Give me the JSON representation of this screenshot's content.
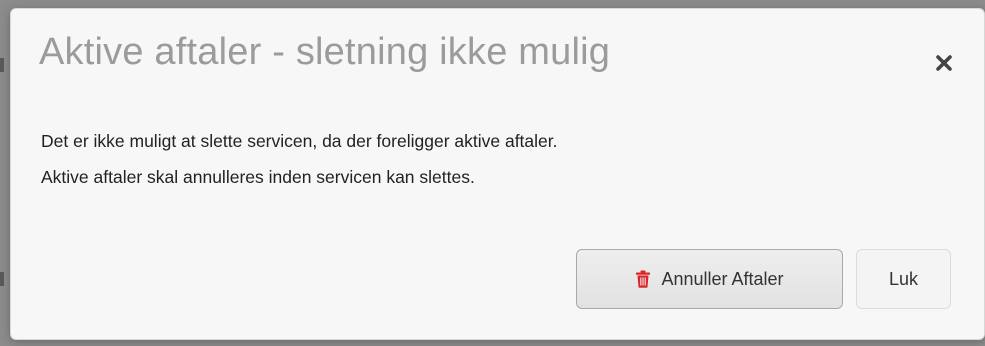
{
  "dialog": {
    "title": "Aktive aftaler - sletning ikke mulig",
    "close_icon": "close-x-icon",
    "body_lines": [
      "Det er ikke muligt at slette servicen, da der foreligger aktive aftaler.",
      "Aktive aftaler skal annulleres inden servicen kan slettes."
    ],
    "buttons": {
      "cancel_agreements_label": "Annuller Aftaler",
      "cancel_agreements_icon": "trash-icon",
      "close_label": "Luk"
    }
  },
  "colors": {
    "title": "#9b9b9b",
    "trash_icon": "#d9262b",
    "modal_background": "#f7f7f7"
  }
}
